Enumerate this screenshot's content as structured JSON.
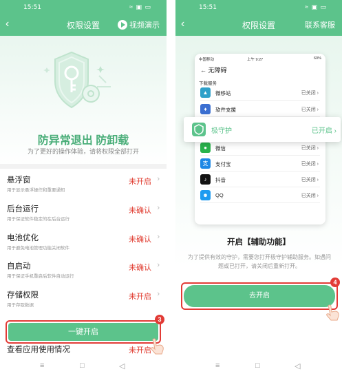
{
  "left": {
    "status_time": "15:51",
    "nav_title": "权限设置",
    "nav_right": "视频演示",
    "hero_title": "防异常退出 防卸载",
    "hero_sub": "为了更好的操作体验，请将权限全部打开",
    "permissions": [
      {
        "name": "悬浮窗",
        "desc": "用于显示悬浮操作和重要通知",
        "state": "未开启"
      },
      {
        "name": "后台运行",
        "desc": "用于保证软件稳定的在后台运行",
        "state": "未确认"
      },
      {
        "name": "电池优化",
        "desc": "用于避免电池管理功能关闭软件",
        "state": "未确认"
      },
      {
        "name": "自启动",
        "desc": "用于保证手机重启后软件自动运行",
        "state": "未确认"
      },
      {
        "name": "存储权限",
        "desc": "用于存取数据",
        "state": "未开启"
      },
      {
        "name": "查看应用使用情况",
        "desc": "",
        "state": "未开启"
      }
    ],
    "onekey_label": "一键开启",
    "step_badge": "3"
  },
  "right": {
    "status_time": "15:51",
    "nav_title": "权限设置",
    "nav_right": "联系客服",
    "phone": {
      "carrier": "中国移动",
      "time": "上午 9:27",
      "battery": "60%",
      "title": "无障碍",
      "section": "下载服务",
      "rows_top": [
        {
          "name": "微移站",
          "state": "已关闭",
          "color": "#2fa0c9"
        },
        {
          "name": "软件支援",
          "state": "已关闭",
          "color": "#3b6fd1"
        }
      ],
      "rows_bottom": [
        {
          "name": "微信",
          "state": "已关闭",
          "color": "#29b34c"
        },
        {
          "name": "支付宝",
          "state": "已关闭",
          "color": "#1e88e5"
        },
        {
          "name": "抖音",
          "state": "已关闭",
          "color": "#111111"
        },
        {
          "name": "QQ",
          "state": "已关闭",
          "color": "#1e9bf0"
        }
      ]
    },
    "highlight": {
      "name": "极守护",
      "state": "已开启"
    },
    "title": "开启【辅助功能】",
    "desc": "为了提供有效的守护，需要您打开极守护辅助服务。如遇问题或已打开，请关闭后重新打开。",
    "go_label": "去开启",
    "step_badge": "4"
  },
  "accent": "#5cc38b",
  "alert": "#e23b36"
}
